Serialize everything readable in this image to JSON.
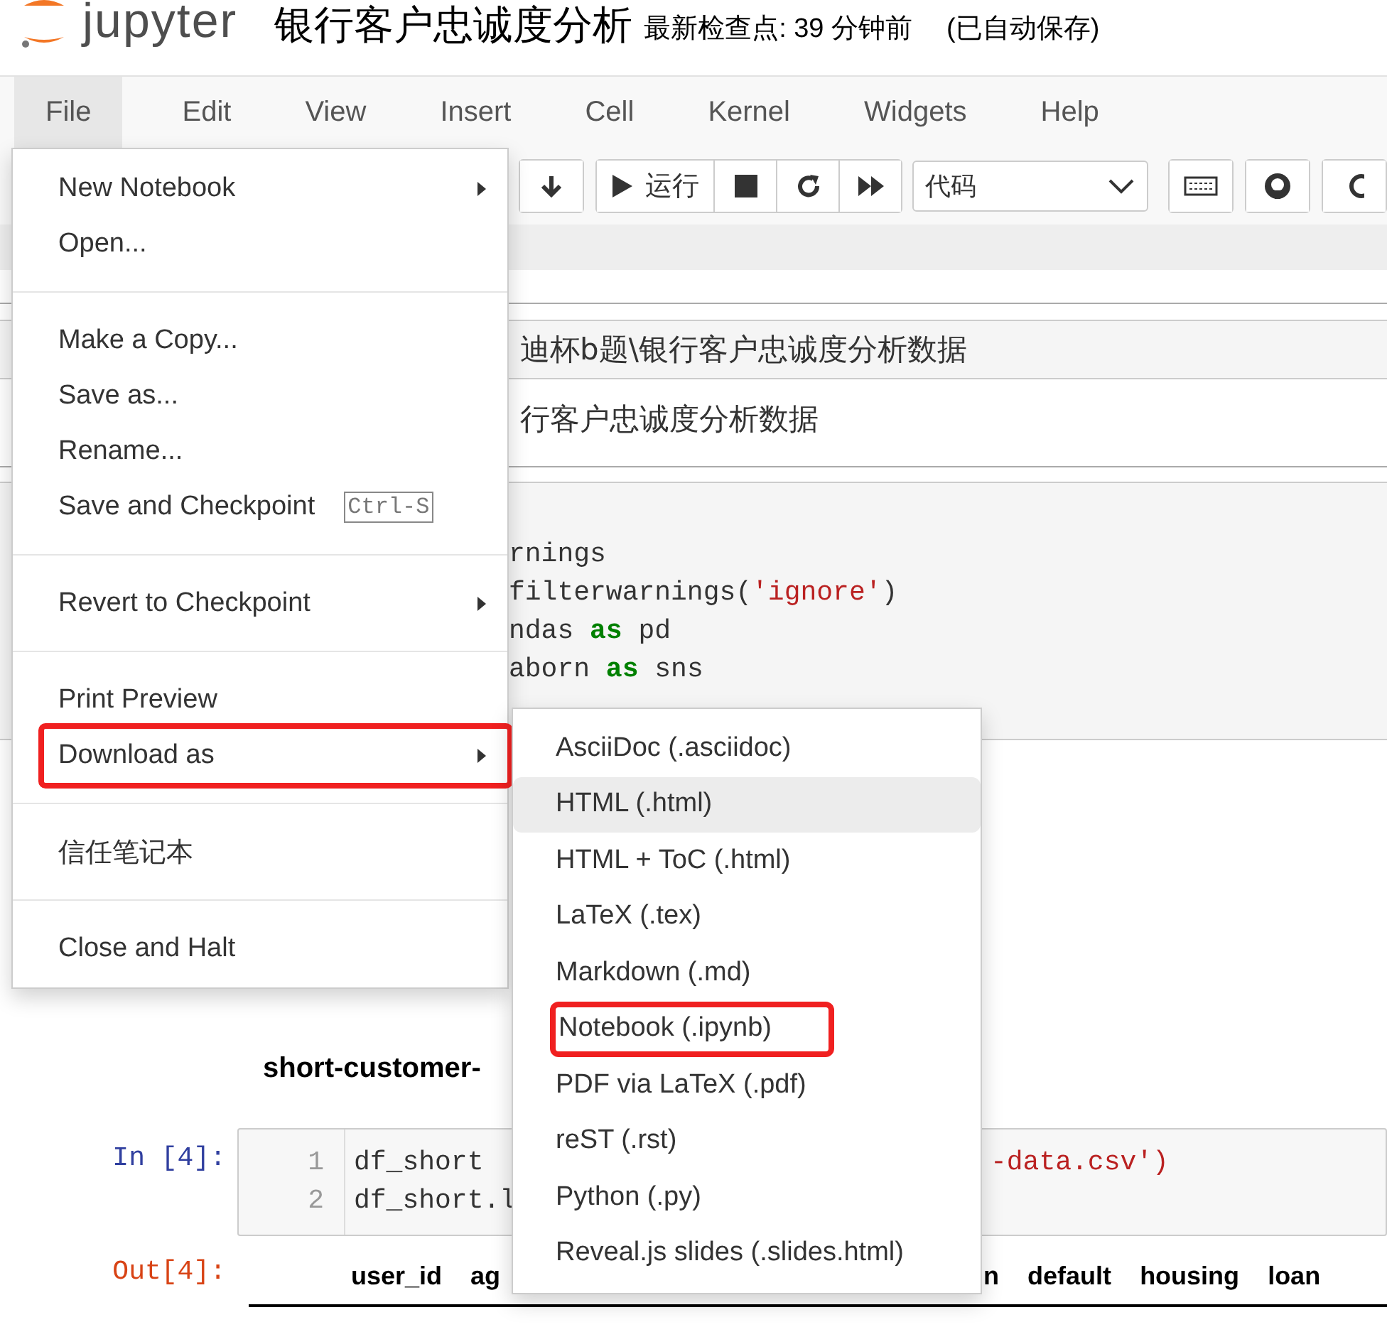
{
  "header": {
    "logo": "jupyter",
    "title": "银行客户忠诚度分析",
    "checkpoint": "最新检查点: 39 分钟前",
    "autosave": "(已自动保存)"
  },
  "menubar": [
    {
      "label": "File",
      "selected": true
    },
    {
      "label": "Edit",
      "selected": false
    },
    {
      "label": "View",
      "selected": false
    },
    {
      "label": "Insert",
      "selected": false
    },
    {
      "label": "Cell",
      "selected": false
    },
    {
      "label": "Kernel",
      "selected": false
    },
    {
      "label": "Widgets",
      "selected": false
    },
    {
      "label": "Help",
      "selected": false
    }
  ],
  "toolbar": {
    "run_label": "运行",
    "cell_type": "代码"
  },
  "notebook": {
    "path_line": "迪杯b题\\银行客户忠诚度分析数据",
    "path_line_2": "行客户忠诚度分析数据",
    "code_lines": [
      [
        {
          "kind": "plain",
          "text": "rnings"
        }
      ],
      [
        {
          "kind": "plain",
          "text": "filterwarnings("
        },
        {
          "kind": "string",
          "text": "'ignore'"
        },
        {
          "kind": "plain",
          "text": ")"
        }
      ],
      [
        {
          "kind": "plain",
          "text": "ndas "
        },
        {
          "kind": "keyword",
          "text": "as"
        },
        {
          "kind": "plain",
          "text": " pd"
        }
      ],
      [
        {
          "kind": "plain",
          "text": "aborn "
        },
        {
          "kind": "keyword",
          "text": "as"
        },
        {
          "kind": "plain",
          "text": " sns"
        }
      ]
    ],
    "heading": "short-customer-",
    "in_prompt": "In  [4]:",
    "code2": [
      {
        "number": "1",
        "left": "df_short",
        "right": "-data.csv')"
      },
      {
        "number": "2",
        "left": "df_short.l"
      }
    ],
    "out_prompt": "Out[4]:",
    "columns_left": [
      "user_id",
      "ag"
    ],
    "columns_right": [
      "n",
      "default",
      "housing",
      "loan"
    ]
  },
  "file_menu": [
    {
      "kind": "item",
      "label": "New Notebook",
      "submenu": true,
      "marked": false
    },
    {
      "kind": "item",
      "label": "Open...",
      "submenu": false,
      "marked": false
    },
    {
      "kind": "divider"
    },
    {
      "kind": "item",
      "label": "Make a Copy...",
      "submenu": false,
      "marked": false
    },
    {
      "kind": "item",
      "label": "Save as...",
      "submenu": false,
      "marked": false
    },
    {
      "kind": "item",
      "label": "Rename...",
      "submenu": false,
      "marked": false
    },
    {
      "kind": "item",
      "label": "Save and Checkpoint",
      "submenu": false,
      "marked": false,
      "shortcut": "Ctrl-S"
    },
    {
      "kind": "divider"
    },
    {
      "kind": "item",
      "label": "Revert to Checkpoint",
      "submenu": true,
      "marked": false
    },
    {
      "kind": "divider"
    },
    {
      "kind": "item",
      "label": "Print Preview",
      "submenu": false,
      "marked": false
    },
    {
      "kind": "item",
      "label": "Download as",
      "submenu": true,
      "marked": true
    },
    {
      "kind": "divider"
    },
    {
      "kind": "item",
      "label": "信任笔记本",
      "submenu": false,
      "marked": false
    },
    {
      "kind": "divider"
    },
    {
      "kind": "item",
      "label": "Close and Halt",
      "submenu": false,
      "marked": false
    }
  ],
  "download_menu": [
    {
      "label": "AsciiDoc (.asciidoc)",
      "hover": false,
      "marked": false
    },
    {
      "label": "HTML (.html)",
      "hover": true,
      "marked": false
    },
    {
      "label": "HTML + ToC (.html)",
      "hover": false,
      "marked": false
    },
    {
      "label": "LaTeX (.tex)",
      "hover": false,
      "marked": false
    },
    {
      "label": "Markdown (.md)",
      "hover": false,
      "marked": false
    },
    {
      "label": "Notebook (.ipynb)",
      "hover": false,
      "marked": true
    },
    {
      "label": "PDF via LaTeX (.pdf)",
      "hover": false,
      "marked": false
    },
    {
      "label": "reST (.rst)",
      "hover": false,
      "marked": false
    },
    {
      "label": "Python (.py)",
      "hover": false,
      "marked": false
    },
    {
      "label": "Reveal.js slides (.slides.html)",
      "hover": false,
      "marked": false
    }
  ]
}
